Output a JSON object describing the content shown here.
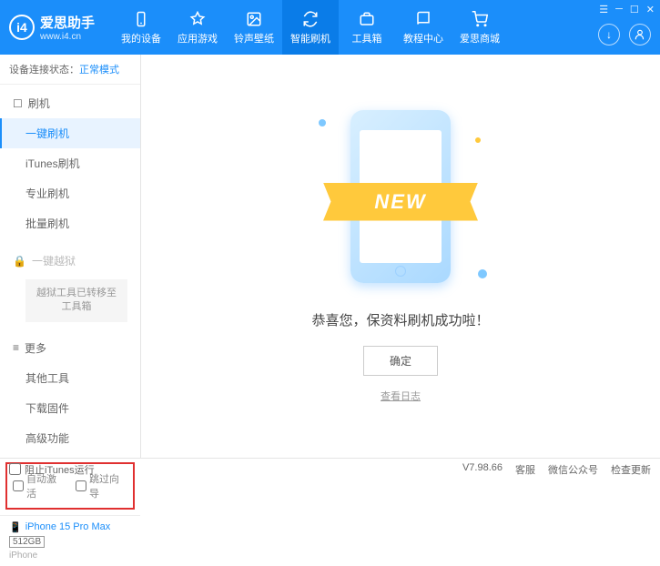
{
  "header": {
    "logo_title": "爱思助手",
    "logo_sub": "www.i4.cn",
    "nav": [
      {
        "label": "我的设备"
      },
      {
        "label": "应用游戏"
      },
      {
        "label": "铃声壁纸"
      },
      {
        "label": "智能刷机"
      },
      {
        "label": "工具箱"
      },
      {
        "label": "教程中心"
      },
      {
        "label": "爱思商城"
      }
    ]
  },
  "sidebar": {
    "status_label": "设备连接状态：",
    "status_value": "正常模式",
    "flash_head": "刷机",
    "flash_items": [
      "一键刷机",
      "iTunes刷机",
      "专业刷机",
      "批量刷机"
    ],
    "jailbreak_head": "一键越狱",
    "jailbreak_note": "越狱工具已转移至工具箱",
    "more_head": "更多",
    "more_items": [
      "其他工具",
      "下载固件",
      "高级功能"
    ],
    "chk_auto": "自动激活",
    "chk_skip": "跳过向导",
    "device_name": "iPhone 15 Pro Max",
    "device_storage": "512GB",
    "device_type": "iPhone"
  },
  "main": {
    "ribbon": "NEW",
    "success": "恭喜您，保资料刷机成功啦！",
    "ok": "确定",
    "log": "查看日志"
  },
  "footer": {
    "block_itunes": "阻止iTunes运行",
    "version": "V7.98.66",
    "links": [
      "客服",
      "微信公众号",
      "检查更新"
    ]
  }
}
